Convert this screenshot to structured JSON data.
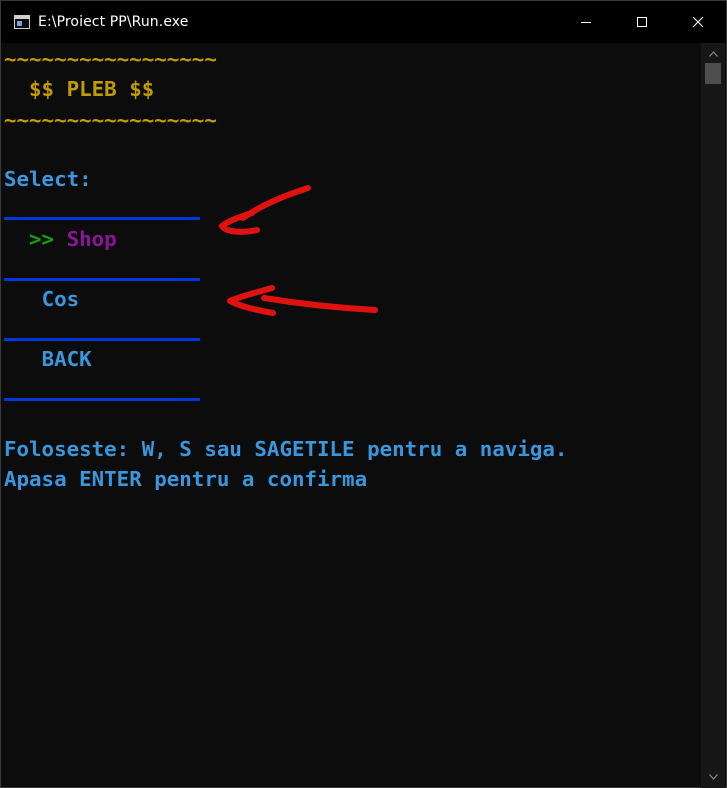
{
  "window": {
    "title": "E:\\Proiect PP\\Run.exe",
    "controls": {
      "minimize_icon": "minimize-icon",
      "maximize_icon": "maximize-icon",
      "close_icon": "close-icon"
    }
  },
  "console": {
    "banner_top": "~~~~~~~~~~~~~~~~~",
    "banner_title": "  $$ PLEB $$",
    "banner_bottom": "~~~~~~~~~~~~~~~~~",
    "prompt": "Select:",
    "menu": {
      "selected_marker": "  >> ",
      "items": [
        {
          "label": "Shop",
          "selected": true
        },
        {
          "label": "Cos",
          "selected": false
        },
        {
          "label": "BACK",
          "selected": false
        }
      ],
      "indent": "   "
    },
    "help_line_1": "Foloseste: W, S sau SAGETILE pentru a naviga.",
    "help_line_2": "Apasa ENTER pentru a confirma"
  },
  "colors": {
    "background": "#0c0c0c",
    "banner": "#c19c00",
    "text": "#3a96dd",
    "marker": "#13a10e",
    "selected_item": "#881798",
    "separator": "#0037da",
    "annotation": "#e0120f"
  }
}
